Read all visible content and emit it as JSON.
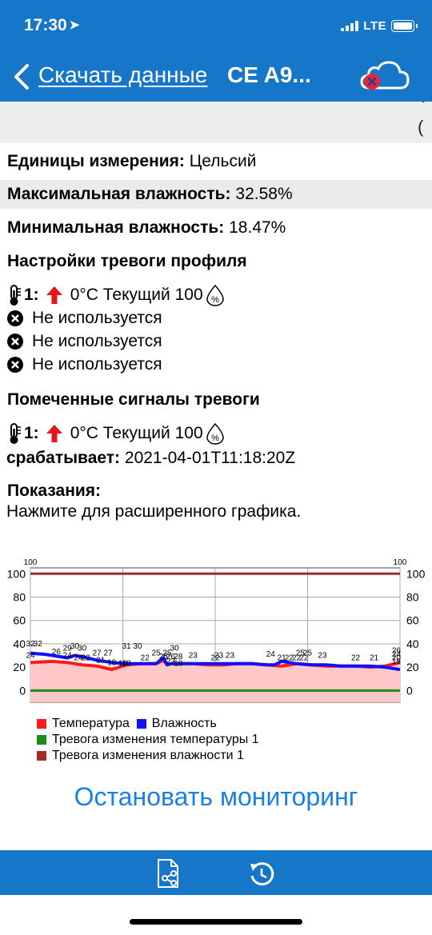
{
  "status_bar": {
    "time": "17:30",
    "network": "LTE"
  },
  "nav": {
    "back_label": "Скачать данные",
    "title": "CE A9..."
  },
  "info": {
    "units_label": "Единицы измерения:",
    "units_value": "Цельсий",
    "max_label": "Максимальная влажность:",
    "max_value": "32.58%",
    "min_label": "Минимальная влажность:",
    "min_value": "18.47%"
  },
  "profile_alarms": {
    "heading": "Настройки тревоги профиля",
    "alarm1": {
      "index": "1:",
      "text": "0°C Текущий 100"
    },
    "unused": [
      "Не используется",
      "Не используется",
      "Не используется"
    ]
  },
  "flagged_alarms": {
    "heading": "Помеченные сигналы тревоги",
    "alarm1": {
      "index": "1:",
      "text": "0°C Текущий 100"
    },
    "triggered_label": "срабатывает:",
    "triggered_value": "2021-04-01T11:18:20Z"
  },
  "readings": {
    "heading": "Показания:",
    "hint": "Нажмите для расширенного графика."
  },
  "chart_data": {
    "type": "line",
    "ylim": [
      -10,
      105
    ],
    "y_ticks": [
      0,
      20,
      40,
      60,
      80,
      100
    ],
    "grid": true,
    "series": [
      {
        "name": "Температура",
        "color": "#ff1a1a",
        "fill": "#ffc8c8",
        "x": [
          0,
          6,
          10,
          14,
          18,
          22,
          26,
          30,
          34,
          36,
          37,
          38,
          40,
          44,
          48,
          52,
          56,
          60,
          64,
          68,
          72,
          76,
          80,
          84,
          88,
          92,
          96,
          100
        ],
        "values": [
          24,
          25,
          24,
          22,
          21,
          18,
          22,
          23,
          23,
          26,
          22,
          23,
          23,
          23,
          22,
          22,
          23,
          23,
          22,
          21,
          23,
          22,
          21,
          21,
          21,
          20,
          21,
          24
        ]
      },
      {
        "name": "Влажность",
        "color": "#1010ff",
        "x": [
          0,
          4,
          8,
          10,
          12,
          14,
          18,
          22,
          26,
          30,
          34,
          36,
          37,
          38,
          40,
          44,
          48,
          52,
          56,
          60,
          64,
          66,
          68,
          70,
          72,
          76,
          80,
          84,
          88,
          92,
          96,
          100
        ],
        "values": [
          32,
          31,
          29,
          28,
          30,
          29,
          26,
          24,
          23,
          23,
          23,
          28,
          22,
          23,
          23,
          23,
          23,
          23,
          23,
          23,
          22,
          22,
          25,
          24,
          23,
          22,
          22,
          21,
          21,
          21,
          20,
          18
        ]
      },
      {
        "name": "Тревога изменения температуры 1",
        "color": "#1a8c1a",
        "values": [
          0
        ]
      },
      {
        "name": "Тревога изменения влажности 1",
        "color": "#a52a2a",
        "values": [
          100
        ]
      }
    ],
    "data_labels": [
      {
        "x": 0,
        "y": 38,
        "t": "32"
      },
      {
        "x": 2,
        "y": 38,
        "t": "32"
      },
      {
        "x": 0,
        "y": 28,
        "t": "24"
      },
      {
        "x": 7,
        "y": 31,
        "t": "26"
      },
      {
        "x": 10,
        "y": 34,
        "t": "29"
      },
      {
        "x": 12,
        "y": 36,
        "t": "30"
      },
      {
        "x": 14,
        "y": 34,
        "t": "30"
      },
      {
        "x": 10,
        "y": 28,
        "t": "24"
      },
      {
        "x": 13,
        "y": 26,
        "t": "24"
      },
      {
        "x": 15,
        "y": 26,
        "t": "22"
      },
      {
        "x": 18,
        "y": 30,
        "t": "27"
      },
      {
        "x": 21,
        "y": 30,
        "t": "27"
      },
      {
        "x": 19,
        "y": 24,
        "t": "21"
      },
      {
        "x": 22,
        "y": 22,
        "t": "18"
      },
      {
        "x": 25,
        "y": 21,
        "t": "18"
      },
      {
        "x": 26,
        "y": 21,
        "t": "18"
      },
      {
        "x": 26,
        "y": 36,
        "t": "31"
      },
      {
        "x": 29,
        "y": 36,
        "t": "30"
      },
      {
        "x": 31,
        "y": 26,
        "t": "22"
      },
      {
        "x": 34,
        "y": 30,
        "t": "25"
      },
      {
        "x": 37,
        "y": 30,
        "t": "25"
      },
      {
        "x": 39,
        "y": 34,
        "t": "30"
      },
      {
        "x": 36,
        "y": 27,
        "t": "25"
      },
      {
        "x": 38,
        "y": 27,
        "t": "26"
      },
      {
        "x": 40,
        "y": 27,
        "t": "28"
      },
      {
        "x": 38,
        "y": 23,
        "t": "23"
      },
      {
        "x": 40,
        "y": 21,
        "t": "18"
      },
      {
        "x": 44,
        "y": 28,
        "t": "23"
      },
      {
        "x": 51,
        "y": 28,
        "t": "23"
      },
      {
        "x": 50,
        "y": 26,
        "t": "22"
      },
      {
        "x": 54,
        "y": 28,
        "t": "23"
      },
      {
        "x": 65,
        "y": 29,
        "t": "24"
      },
      {
        "x": 68,
        "y": 26,
        "t": "21"
      },
      {
        "x": 70,
        "y": 26,
        "t": "22"
      },
      {
        "x": 72,
        "y": 26,
        "t": "22"
      },
      {
        "x": 73,
        "y": 30,
        "t": "25"
      },
      {
        "x": 75,
        "y": 30,
        "t": "25"
      },
      {
        "x": 74,
        "y": 26,
        "t": "22"
      },
      {
        "x": 79,
        "y": 28,
        "t": "23"
      },
      {
        "x": 88,
        "y": 26,
        "t": "22"
      },
      {
        "x": 93,
        "y": 26,
        "t": "21"
      },
      {
        "x": 99,
        "y": 32,
        "t": "26"
      },
      {
        "x": 99,
        "y": 29,
        "t": "24"
      },
      {
        "x": 99,
        "y": 26,
        "t": "20"
      },
      {
        "x": 99,
        "y": 23,
        "t": "18"
      }
    ]
  },
  "legend": [
    {
      "label": "Температура",
      "color": "#ff1a1a"
    },
    {
      "label": "Влажность",
      "color": "#1010ff"
    },
    {
      "label": "Тревога изменения температуры 1",
      "color": "#1a8c1a"
    },
    {
      "label": "Тревога изменения влажности 1",
      "color": "#a52a2a"
    }
  ],
  "actions": {
    "stop_label": "Остановать мониторинг"
  },
  "toolbar": {
    "share_icon": "share-file-icon",
    "refresh_icon": "refresh-history-icon"
  }
}
